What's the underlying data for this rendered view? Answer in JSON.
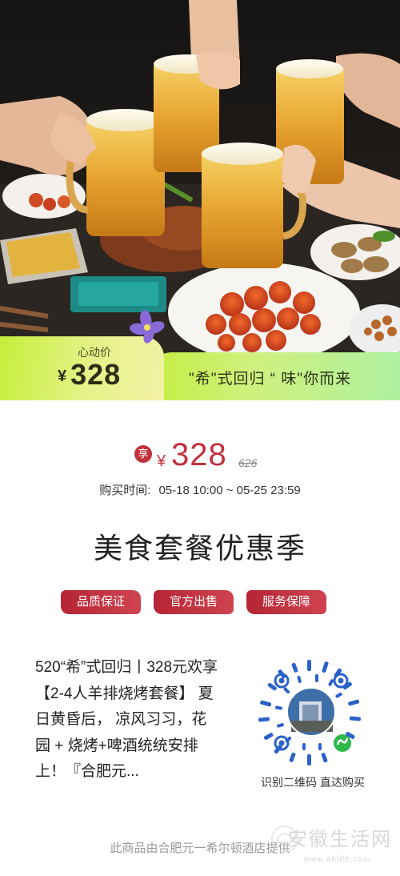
{
  "banner": {
    "caption": "心动价",
    "price_symbol": "¥",
    "price": "328",
    "slogan": "\"希\"式回归 “ 味\"你而来"
  },
  "deal": {
    "badge": "享",
    "symbol": "¥",
    "price": "328",
    "original_price": "626"
  },
  "buy_time": {
    "label": "购买时间:",
    "range": "05-18 10:00 ~ 05-25 23:59"
  },
  "title": "美食套餐优惠季",
  "tags": [
    "品质保证",
    "官方出售",
    "服务保障"
  ],
  "description": "520“希”式回归丨328元欢享【2-4人羊排烧烤套餐】 夏日黄昏后， 凉风习习，花园 + 烧烤+啤酒统统安排上！『合肥元...",
  "qr": {
    "caption": "识别二维码 直达购买",
    "icon": "qr-code-icon"
  },
  "footer": "此商品由合肥元一希尔顿酒店提供",
  "watermark": {
    "text": "安徽生活网",
    "url": "www.ahlife.com"
  },
  "colors": {
    "accent": "#c2303c",
    "banner_green": "#c5ee3a",
    "tag_red": "#b52535"
  }
}
